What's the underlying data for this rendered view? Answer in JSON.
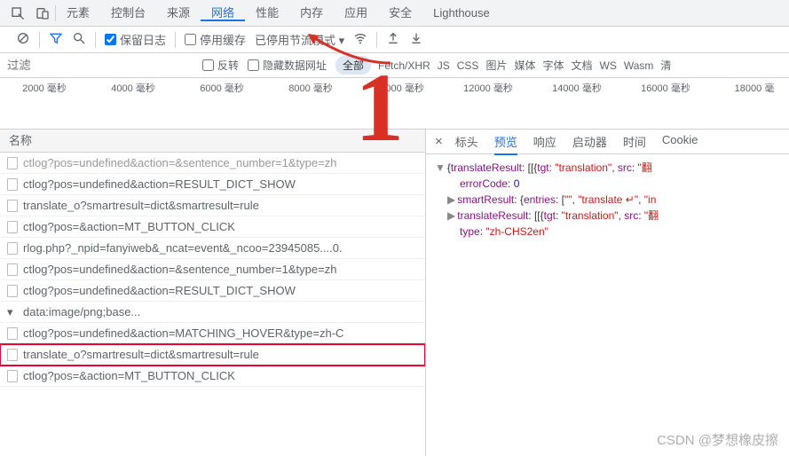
{
  "topTabs": {
    "items": [
      "元素",
      "控制台",
      "来源",
      "网络",
      "性能",
      "内存",
      "应用",
      "安全",
      "Lighthouse"
    ],
    "activeIndex": 3
  },
  "toolbar": {
    "preserveLog": "保留日志",
    "disableCache": "停用缓存",
    "throttleLabel": "已停用节流模式"
  },
  "filterbar": {
    "placeholder": "过滤",
    "invert": "反转",
    "hideData": "隐藏数据网址",
    "types": [
      "全部",
      "Fetch/XHR",
      "JS",
      "CSS",
      "图片",
      "媒体",
      "字体",
      "文档",
      "WS",
      "Wasm",
      "清"
    ],
    "activeType": 0
  },
  "timeline": {
    "ticks": [
      "2000 毫秒",
      "4000 毫秒",
      "6000 毫秒",
      "8000 毫秒",
      "10000 毫秒",
      "12000 毫秒",
      "14000 毫秒",
      "16000 毫秒",
      "18000 毫"
    ]
  },
  "leftHeader": "名称",
  "requests": [
    {
      "text": "ctlog?pos=undefined&action=&sentence_number=1&type=zh",
      "faded": true
    },
    {
      "text": "ctlog?pos=undefined&action=RESULT_DICT_SHOW"
    },
    {
      "text": "translate_o?smartresult=dict&smartresult=rule"
    },
    {
      "text": "ctlog?pos=&action=MT_BUTTON_CLICK"
    },
    {
      "text": "rlog.php?_npid=fanyiweb&_ncat=event&_ncoo=23945085....0."
    },
    {
      "text": "ctlog?pos=undefined&action=&sentence_number=1&type=zh"
    },
    {
      "text": "ctlog?pos=undefined&action=RESULT_DICT_SHOW"
    },
    {
      "text": "data:image/png;base...",
      "img": true
    },
    {
      "text": "ctlog?pos=undefined&action=MATCHING_HOVER&type=zh-C"
    },
    {
      "text": "translate_o?smartresult=dict&smartresult=rule",
      "selected": true
    },
    {
      "text": "ctlog?pos=&action=MT_BUTTON_CLICK"
    }
  ],
  "rightTabs": {
    "items": [
      "标头",
      "预览",
      "响应",
      "启动器",
      "时间",
      "Cookie"
    ],
    "activeIndex": 1
  },
  "preview": {
    "lines": [
      {
        "caret": "▼",
        "parts": [
          {
            "t": "{"
          },
          {
            "k": "translateResult"
          },
          {
            "t": ": [[{"
          },
          {
            "k": "tgt"
          },
          {
            "t": ": "
          },
          {
            "s": "\"translation\""
          },
          {
            "t": ", "
          },
          {
            "k": "src"
          },
          {
            "t": ": "
          },
          {
            "s": "\"翻"
          }
        ]
      },
      {
        "indent": 2,
        "parts": [
          {
            "k": "errorCode"
          },
          {
            "t": ": "
          },
          {
            "n": "0"
          }
        ]
      },
      {
        "caret": "▶",
        "indent": 1,
        "parts": [
          {
            "k": "smartResult"
          },
          {
            "t": ": {"
          },
          {
            "k": "entries"
          },
          {
            "t": ": ["
          },
          {
            "s": "\"\""
          },
          {
            "t": ", "
          },
          {
            "s": "\"translate ↵\""
          },
          {
            "t": ", "
          },
          {
            "s": "\"in"
          }
        ]
      },
      {
        "caret": "▶",
        "indent": 1,
        "parts": [
          {
            "k": "translateResult"
          },
          {
            "t": ": [[{"
          },
          {
            "k": "tgt"
          },
          {
            "t": ": "
          },
          {
            "s": "\"translation\""
          },
          {
            "t": ", "
          },
          {
            "k": "src"
          },
          {
            "t": ": "
          },
          {
            "s": "\"翻"
          }
        ]
      },
      {
        "indent": 2,
        "parts": [
          {
            "k": "type"
          },
          {
            "t": ": "
          },
          {
            "s": "\"zh-CHS2en\""
          }
        ]
      }
    ]
  },
  "annotation": "1",
  "watermark": "CSDN @梦想橡皮擦"
}
